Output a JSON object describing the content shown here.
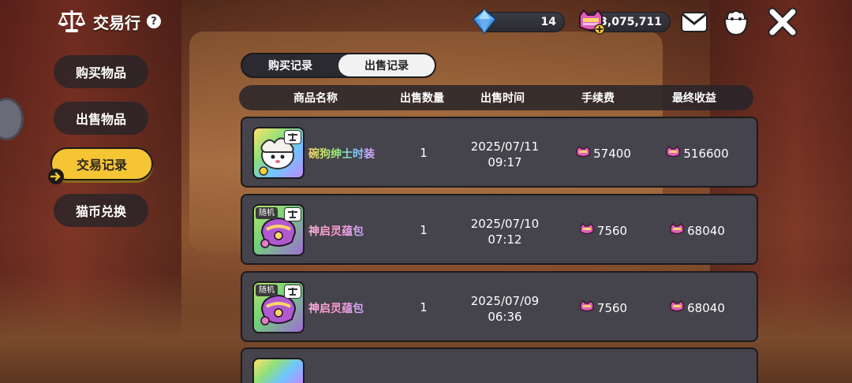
{
  "header": {
    "title": "交易行",
    "help": "?"
  },
  "currency": {
    "gems": "14",
    "coins": "3,075,711"
  },
  "sidebar": {
    "items": [
      {
        "label": "购买物品"
      },
      {
        "label": "出售物品"
      },
      {
        "label": "交易记录",
        "active": true
      },
      {
        "label": "猫币兑换"
      }
    ]
  },
  "tabs": [
    {
      "label": "购买记录"
    },
    {
      "label": "出售记录",
      "active": true
    }
  ],
  "table": {
    "columns": [
      "商品名称",
      "出售数量",
      "出售时间",
      "手续费",
      "最终收益"
    ],
    "rows": [
      {
        "name": "碗狗绅士时装",
        "qty": "1",
        "date": "2025/07/11",
        "time": "09:17",
        "fee": "57400",
        "income": "516600",
        "badge": ""
      },
      {
        "name": "神启灵蕴包",
        "qty": "1",
        "date": "2025/07/10",
        "time": "07:12",
        "fee": "7560",
        "income": "68040",
        "badge": "随机"
      },
      {
        "name": "神启灵蕴包",
        "qty": "1",
        "date": "2025/07/09",
        "time": "06:36",
        "fee": "7560",
        "income": "68040",
        "badge": "随机"
      }
    ]
  },
  "colors": {
    "accent": "#f5c534",
    "row_bg": "#45434b"
  }
}
